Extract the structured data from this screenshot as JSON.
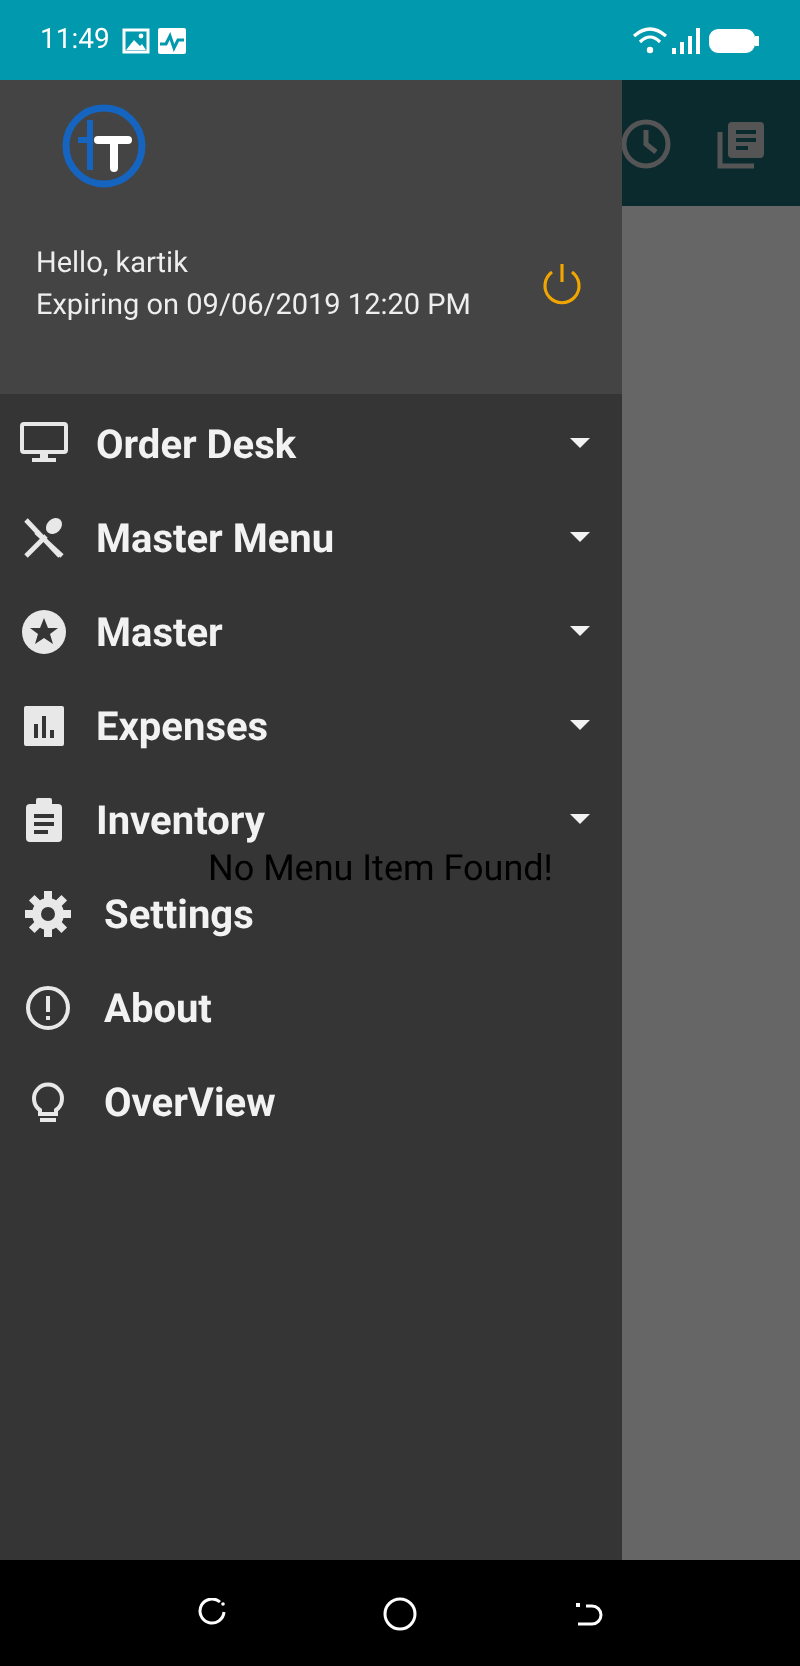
{
  "status_bar": {
    "time": "11:49"
  },
  "drawer": {
    "greeting": "Hello, kartik",
    "expiry": "Expiring on 09/06/2019 12:20 PM",
    "items": [
      {
        "label": "Order Desk",
        "expandable": true
      },
      {
        "label": "Master Menu",
        "expandable": true
      },
      {
        "label": "Master",
        "expandable": true
      },
      {
        "label": "Expenses",
        "expandable": true
      },
      {
        "label": "Inventory",
        "expandable": true
      },
      {
        "label": "Settings",
        "expandable": false
      },
      {
        "label": "About",
        "expandable": false
      },
      {
        "label": "OverView",
        "expandable": false
      }
    ]
  },
  "content": {
    "empty_message": "No Menu Item Found!"
  }
}
